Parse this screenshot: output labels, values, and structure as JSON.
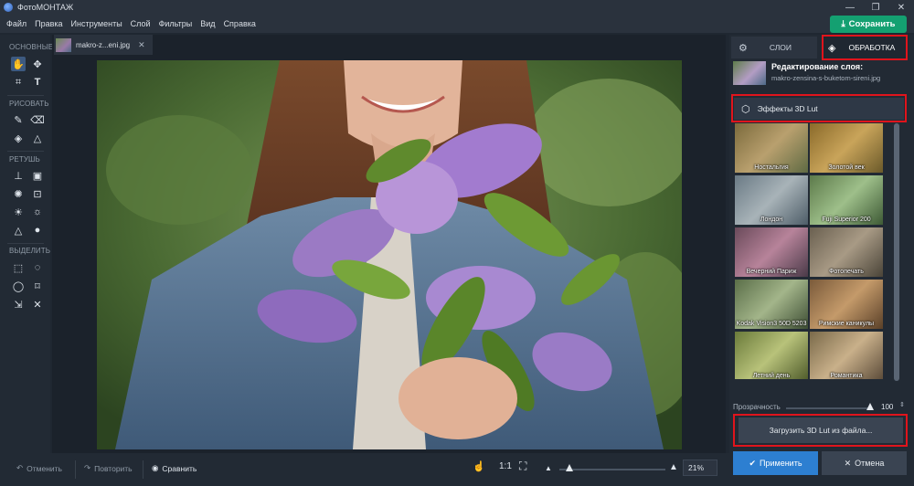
{
  "window": {
    "title": "ФотоМОНТАЖ"
  },
  "menu": [
    "Файл",
    "Правка",
    "Инструменты",
    "Слой",
    "Фильтры",
    "Вид",
    "Справка"
  ],
  "save_label": "Сохранить",
  "tools": {
    "sections": [
      "ОСНОВНЫЕ",
      "РИСОВАТЬ",
      "РЕТУШЬ",
      "ВЫДЕЛИТЬ"
    ]
  },
  "document_tab": {
    "name": "makro-z...eni.jpg"
  },
  "right_panel": {
    "tabs": [
      "СЛОИ",
      "ОБРАБОТКА"
    ],
    "layer_title": "Редактирование слоя:",
    "layer_file": "makro-zensina-s-buketom-sireni.jpg",
    "effects_header": "Эффекты 3D Lut",
    "presets": [
      "Ностальгия",
      "Золотой век",
      "Лондон",
      "Fuji Superior 200",
      "Вечерний Париж",
      "Фотопечать",
      "Kodak Vision3 50D 5203",
      "Римские каникулы",
      "Летний день",
      "Романтика"
    ],
    "opacity_label": "Прозрачность",
    "opacity_value": "100",
    "opacity_level": 1.0,
    "load_label": "Загрузить 3D Lut из файла...",
    "apply_label": "Применить",
    "cancel_label": "Отмена"
  },
  "bottom_bar": {
    "undo_label": "Отменить",
    "redo_label": "Повторить",
    "compare_label": "Сравнить",
    "ratio_label": "1:1",
    "zoom_value": "21%"
  },
  "accent_colors": {
    "save": "#14a071",
    "apply": "#2d7fd1",
    "highlight": "#e0141c"
  }
}
